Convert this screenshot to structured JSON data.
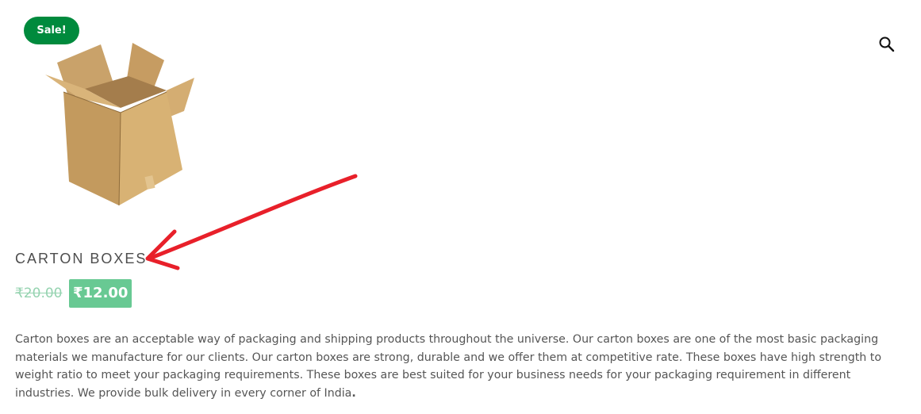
{
  "badge": {
    "sale_label": "Sale!",
    "color": "#008a3d"
  },
  "search": {
    "icon": "search-icon"
  },
  "product": {
    "image_alt": "carton-box-image",
    "title": "CARTON BOXES",
    "old_price": "₹20.00",
    "new_price": "₹12.00",
    "price_color": "#68c993",
    "description": "Carton boxes are an acceptable way of packaging and shipping products throughout the universe. Our carton boxes are one of the most basic packaging materials we manufacture for our clients. Our carton boxes are strong, durable and we offer them at competitive rate. These boxes have high strength to weight ratio to meet your packaging requirements. These boxes are best suited for your business needs for your packaging requirement in different industries. We provide bulk delivery in every corner of India",
    "description_end": "."
  },
  "annotation": {
    "arrow_color": "#e8202a"
  }
}
